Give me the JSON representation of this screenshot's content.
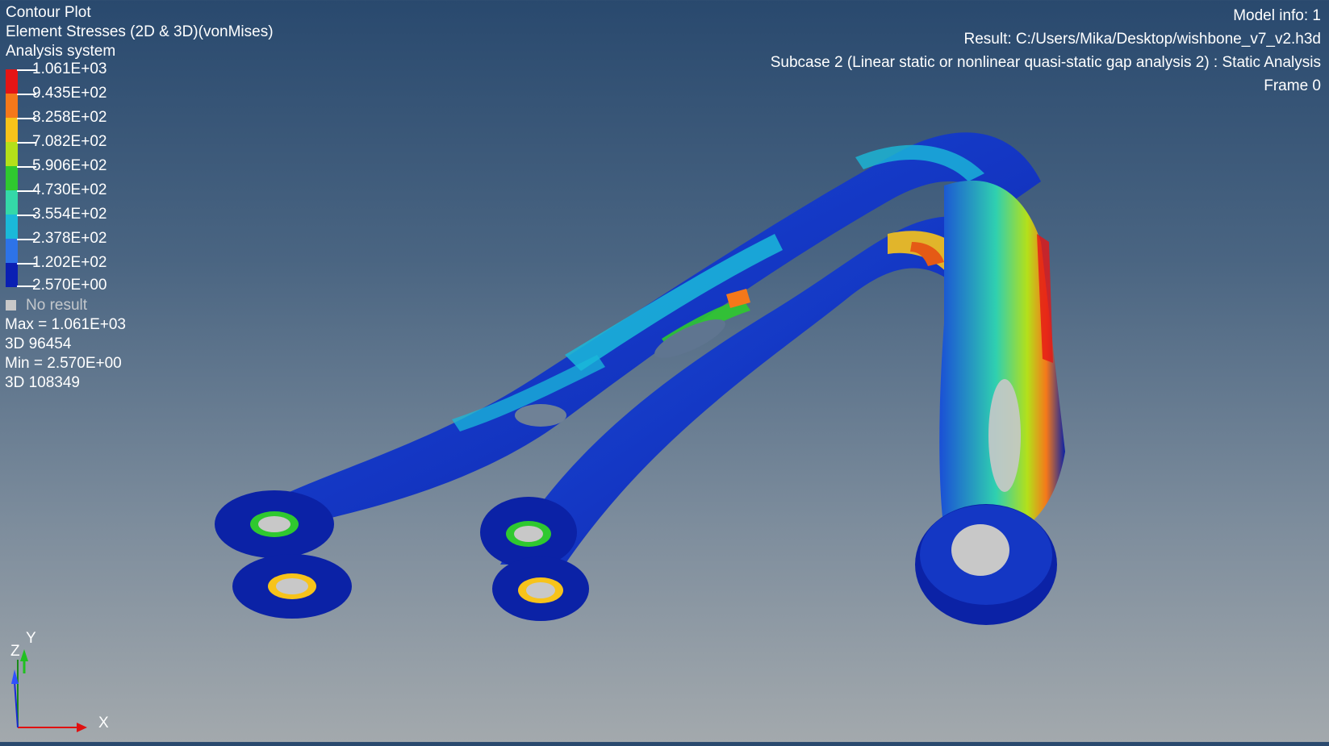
{
  "header_left": {
    "plot_type": "Contour Plot",
    "result_type": "Element Stresses (2D & 3D)(vonMises)",
    "system": "Analysis system"
  },
  "legend": {
    "labels": [
      "1.061E+03",
      "9.435E+02",
      "8.258E+02",
      "7.082E+02",
      "5.906E+02",
      "4.730E+02",
      "3.554E+02",
      "2.378E+02",
      "1.202E+02",
      "2.570E+00"
    ],
    "colors": [
      "#e51515",
      "#f5781a",
      "#f7c31a",
      "#b4e01a",
      "#2fc92f",
      "#34d8a8",
      "#1ab9d9",
      "#2d73e8",
      "#0a1fb3"
    ],
    "no_result_label": "No result"
  },
  "stats": {
    "max_label": "Max = 1.061E+03",
    "max_element": "3D 96454",
    "min_label": "Min = 2.570E+00",
    "min_element": "3D 108349"
  },
  "header_right": {
    "model_info": "Model info: 1",
    "result_path": "Result: C:/Users/Mika/Desktop/wishbone_v7_v2.h3d",
    "subcase": "Subcase 2 (Linear static or nonlinear quasi-static gap analysis 2) : Static Analysis",
    "frame": "Frame 0"
  },
  "triad": {
    "y_label": "Y",
    "z_label": "Z",
    "x_label": "X"
  }
}
